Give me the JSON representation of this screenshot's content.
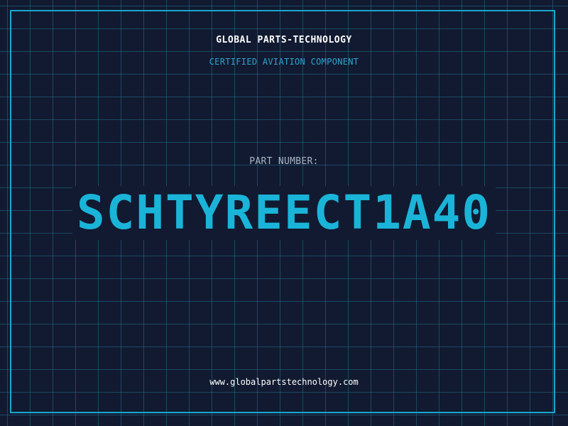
{
  "header": {
    "company": "GLOBAL PARTS-TECHNOLOGY",
    "subtitle": "CERTIFIED AVIATION COMPONENT"
  },
  "part": {
    "label": "PART NUMBER:",
    "number": "SCHTYREECT1A40"
  },
  "footer": {
    "website": "www.globalpartstechnology.com"
  },
  "colors": {
    "background": "#111a30",
    "grid": "#266e8c",
    "accent": "#18a8cc",
    "part_number": "#1ab4d8",
    "subtitle": "#2aa6d0"
  }
}
